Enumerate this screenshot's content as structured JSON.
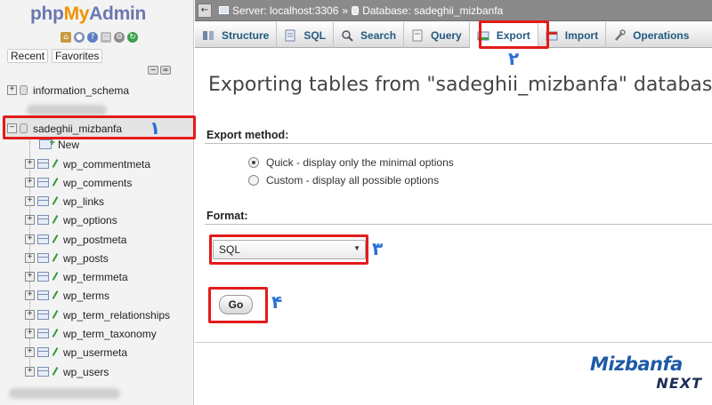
{
  "logo": {
    "php": "php",
    "my": "My",
    "admin": "Admin"
  },
  "nav_tabs": {
    "recent": "Recent",
    "favorites": "Favorites"
  },
  "tree": {
    "databases": [
      {
        "name": "information_schema"
      },
      {
        "name": "sadeghii_mizbanfa"
      }
    ],
    "new_label": "New",
    "tables": [
      "wp_commentmeta",
      "wp_comments",
      "wp_links",
      "wp_options",
      "wp_postmeta",
      "wp_posts",
      "wp_termmeta",
      "wp_terms",
      "wp_term_relationships",
      "wp_term_taxonomy",
      "wp_usermeta",
      "wp_users"
    ]
  },
  "breadcrumb": {
    "server": "Server: localhost:3306",
    "sep": "»",
    "database": "Database: sadeghii_mizbanfa"
  },
  "tabs": [
    {
      "label": "Structure",
      "icon": "structure-icon"
    },
    {
      "label": "SQL",
      "icon": "sql-icon"
    },
    {
      "label": "Search",
      "icon": "search-icon"
    },
    {
      "label": "Query",
      "icon": "query-icon"
    },
    {
      "label": "Export",
      "icon": "export-icon",
      "active": true
    },
    {
      "label": "Import",
      "icon": "import-icon"
    },
    {
      "label": "Operations",
      "icon": "operations-icon"
    }
  ],
  "main": {
    "heading": "Exporting tables from \"sadeghii_mizbanfa\" database",
    "export_method_label": "Export method:",
    "methods": [
      {
        "label": "Quick - display only the minimal options",
        "checked": true
      },
      {
        "label": "Custom - display all possible options",
        "checked": false
      }
    ],
    "format_label": "Format:",
    "format_value": "SQL",
    "go_label": "Go"
  },
  "annotations": {
    "m1": "١",
    "m2": "٢",
    "m3": "٣",
    "m4": "۴"
  },
  "brand": {
    "line1": "Mizbanfa",
    "line2": "NEXT"
  },
  "colors": {
    "accent_red": "#e31b1b",
    "marker_blue": "#2a6fd6",
    "link_blue": "#235a81"
  }
}
